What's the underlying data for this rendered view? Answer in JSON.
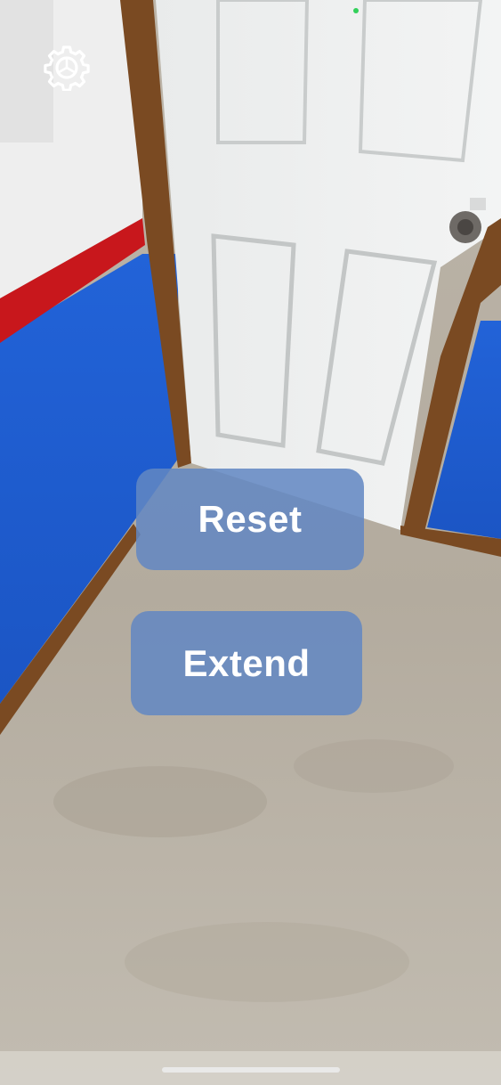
{
  "toolbar": {
    "settings_icon": "gear-icon"
  },
  "buttons": {
    "reset_label": "Reset",
    "extend_label": "Extend"
  },
  "colors": {
    "button_fill": "#6287c3",
    "button_text": "#ffffff",
    "camera_indicator": "#33d05a",
    "wall_blue": "#1f5ed6",
    "chair_rail_red": "#c8171c",
    "door_white": "#eceeee",
    "trim_brown": "#7a4a22",
    "carpet": "#b9b2a6"
  }
}
